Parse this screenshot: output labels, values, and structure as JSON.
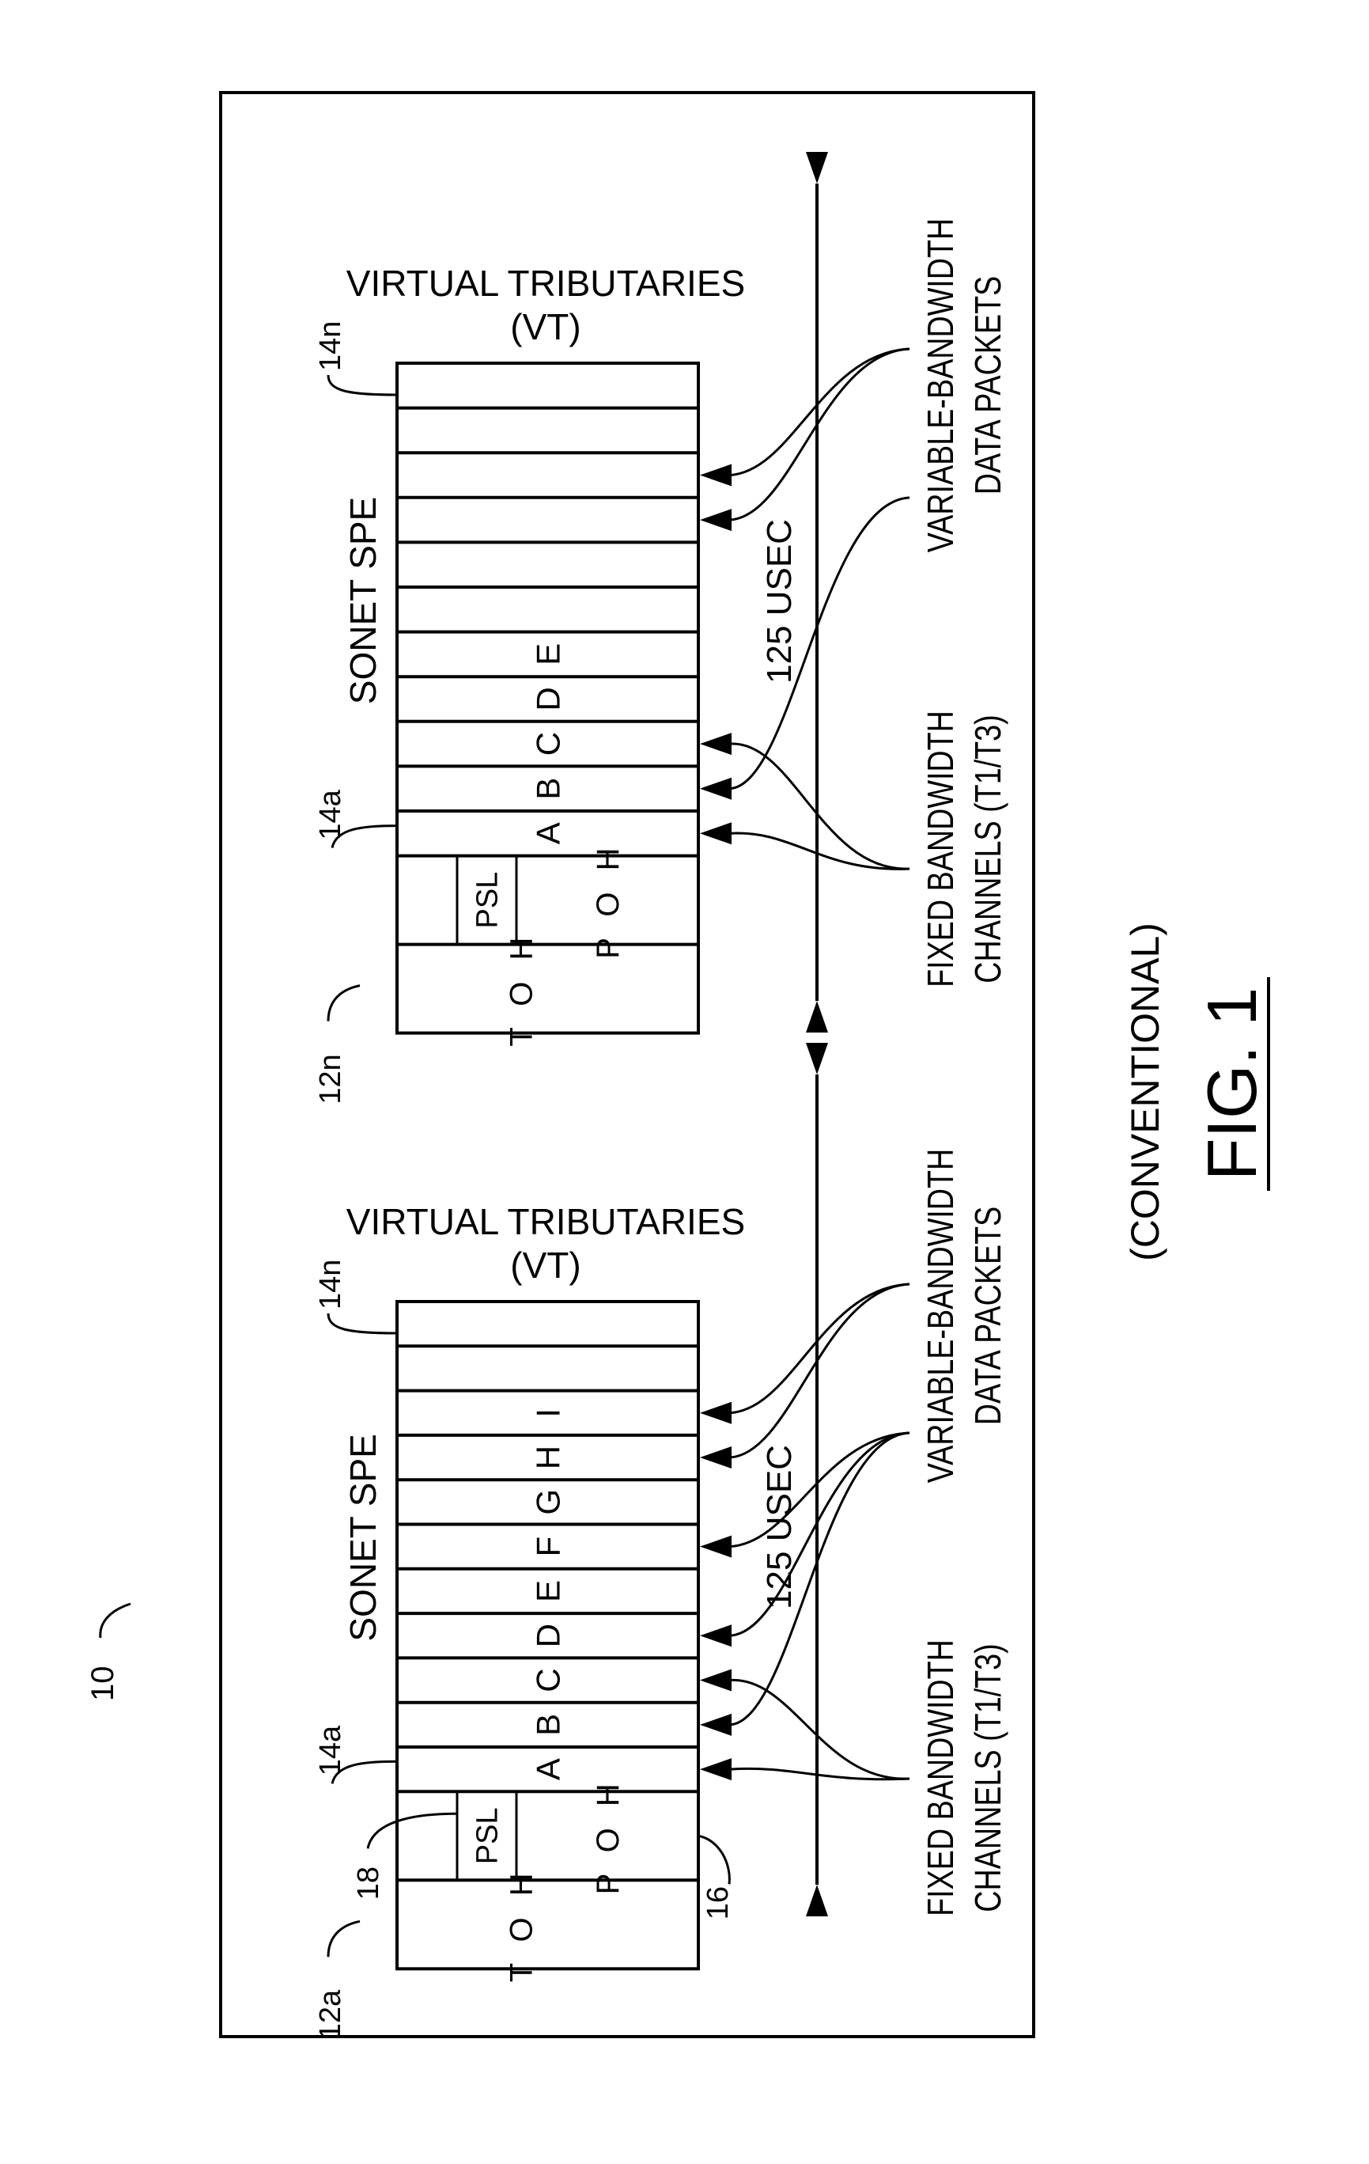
{
  "figure": {
    "reference_numeral": "10",
    "caption": "FIG. 1",
    "subcaption": "(CONVENTIONAL)"
  },
  "frames": [
    {
      "id": "upper",
      "frame_label": "12n",
      "first_vt_label": "14a",
      "last_vt_label": "14n",
      "title_line1": "VIRTUAL TRIBUTARIES",
      "title_line2": "(VT)",
      "spe_label": "SONET SPE",
      "timing_label": "125 USEC",
      "vt_rows": [
        "",
        "",
        "",
        "",
        "",
        "",
        "E",
        "D",
        "C",
        "B",
        "A"
      ],
      "psl_label": "PSL",
      "poh_label": "P O H",
      "toh_label": "T O H",
      "fixed_label_line1": "FIXED BANDWIDTH",
      "fixed_label_line2": "CHANNELS (T1/T3)",
      "variable_label_line1": "VARIABLE-BANDWIDTH",
      "variable_label_line2": "DATA PACKETS"
    },
    {
      "id": "lower",
      "frame_label": "12a",
      "first_vt_label": "14a",
      "last_vt_label": "14n",
      "poh_ref": "16",
      "psl_ref": "18",
      "title_line1": "VIRTUAL TRIBUTARIES",
      "title_line2": "(VT)",
      "spe_label": "SONET SPE",
      "timing_label": "125 USEC",
      "vt_rows": [
        "",
        "",
        "I",
        "H",
        "G",
        "F",
        "E",
        "D",
        "C",
        "B",
        "A"
      ],
      "psl_label": "PSL",
      "poh_label": "P O H",
      "toh_label": "T O H",
      "fixed_label_line1": "FIXED BANDWIDTH",
      "fixed_label_line2": "CHANNELS (T1/T3)",
      "variable_label_line1": "VARIABLE-BANDWIDTH",
      "variable_label_line2": "DATA PACKETS"
    }
  ]
}
